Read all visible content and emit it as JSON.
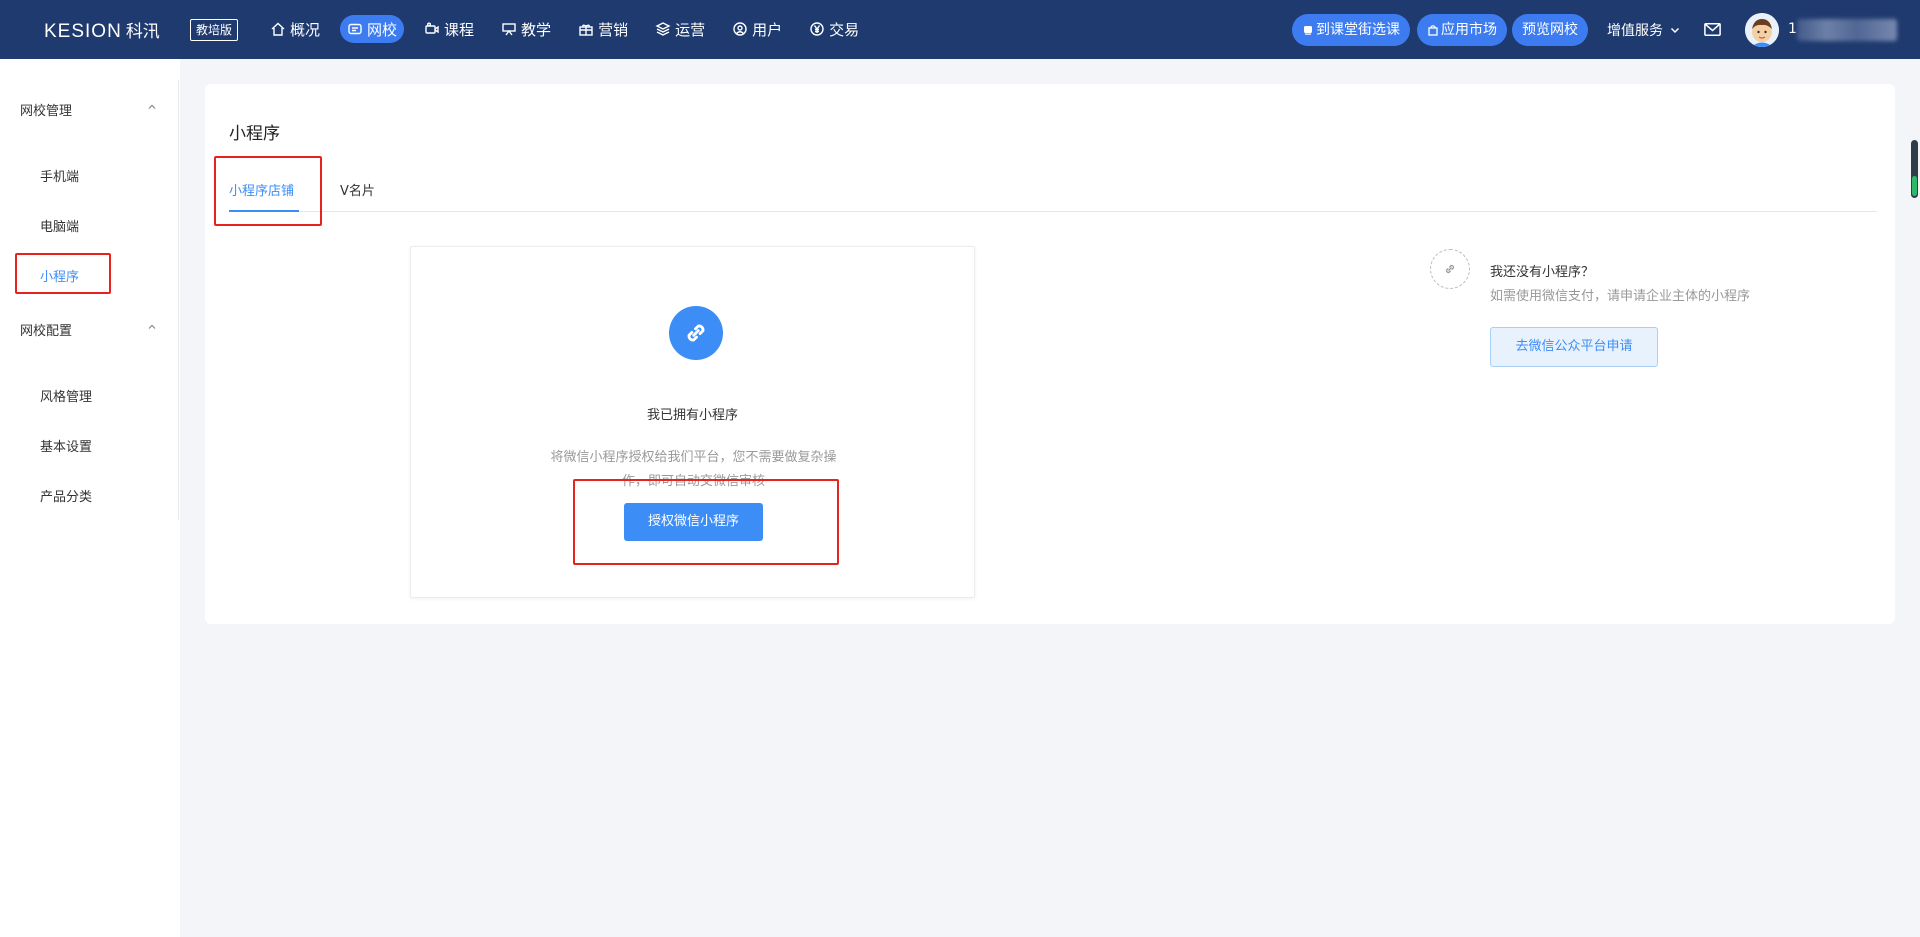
{
  "header": {
    "logo_text": "KESION",
    "logo_cn": "科汛",
    "edition": "教培版",
    "nav": [
      {
        "label": "概况",
        "icon": "home-icon"
      },
      {
        "label": "网校",
        "icon": "school-icon",
        "active": true
      },
      {
        "label": "课程",
        "icon": "video-icon"
      },
      {
        "label": "教学",
        "icon": "teaching-icon"
      },
      {
        "label": "营销",
        "icon": "gift-icon"
      },
      {
        "label": "运营",
        "icon": "layers-icon"
      },
      {
        "label": "用户",
        "icon": "user-icon"
      },
      {
        "label": "交易",
        "icon": "yen-icon"
      }
    ],
    "pills": [
      "到课堂街选课",
      "应用市场",
      "预览网校"
    ],
    "service_label": "增值服务",
    "username_prefix": "1"
  },
  "sidebar": {
    "groups": [
      {
        "title": "网校管理",
        "items": [
          "手机端",
          "电脑端",
          "小程序"
        ]
      },
      {
        "title": "网校配置",
        "items": [
          "风格管理",
          "基本设置",
          "产品分类"
        ]
      }
    ],
    "active_item": "小程序"
  },
  "main": {
    "title": "小程序",
    "tabs": [
      "小程序店铺",
      "V名片"
    ],
    "active_tab": "小程序店铺",
    "owned": {
      "title": "我已拥有小程序",
      "description": "将微信小程序授权给我们平台，您不需要做复杂操作，即可自动交微信审核",
      "button": "授权微信小程序"
    },
    "not_owned": {
      "title": "我还没有小程序？",
      "description": "如需使用微信支付，请申请企业主体的小程序",
      "button": "去微信公众平台申请"
    }
  },
  "colors": {
    "header_bg": "#1f3a6e",
    "accent": "#3d8df7",
    "pill": "#3d7cf0",
    "annotation": "#e8231f"
  }
}
